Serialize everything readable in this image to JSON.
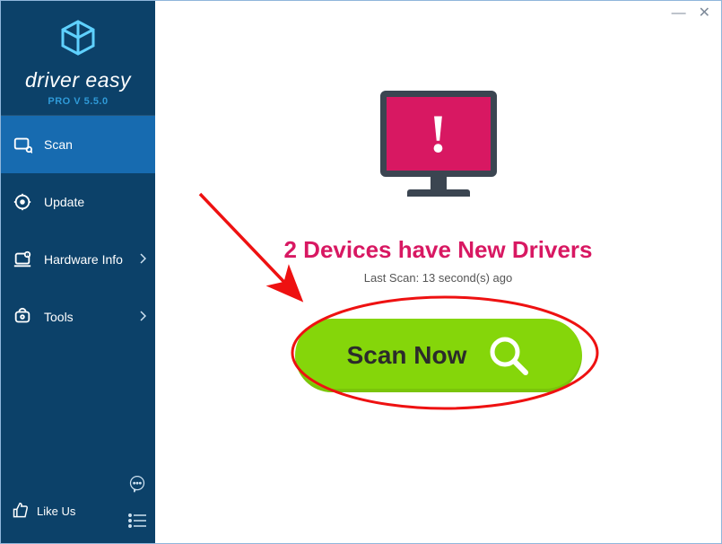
{
  "brand": {
    "name": "driver easy",
    "version": "PRO V 5.5.0"
  },
  "sidebar": {
    "items": [
      {
        "label": "Scan",
        "name": "scan",
        "active": true,
        "chev": false
      },
      {
        "label": "Update",
        "name": "update",
        "active": false,
        "chev": false
      },
      {
        "label": "Hardware Info",
        "name": "hardware-info",
        "active": false,
        "chev": true
      },
      {
        "label": "Tools",
        "name": "tools",
        "active": false,
        "chev": true
      }
    ],
    "like_label": "Like Us"
  },
  "main": {
    "headline": "2 Devices have New Drivers",
    "last_scan": "Last Scan: 13 second(s) ago",
    "scan_button": "Scan Now"
  },
  "titlebar": {
    "minimize": "—",
    "close": "✕"
  }
}
